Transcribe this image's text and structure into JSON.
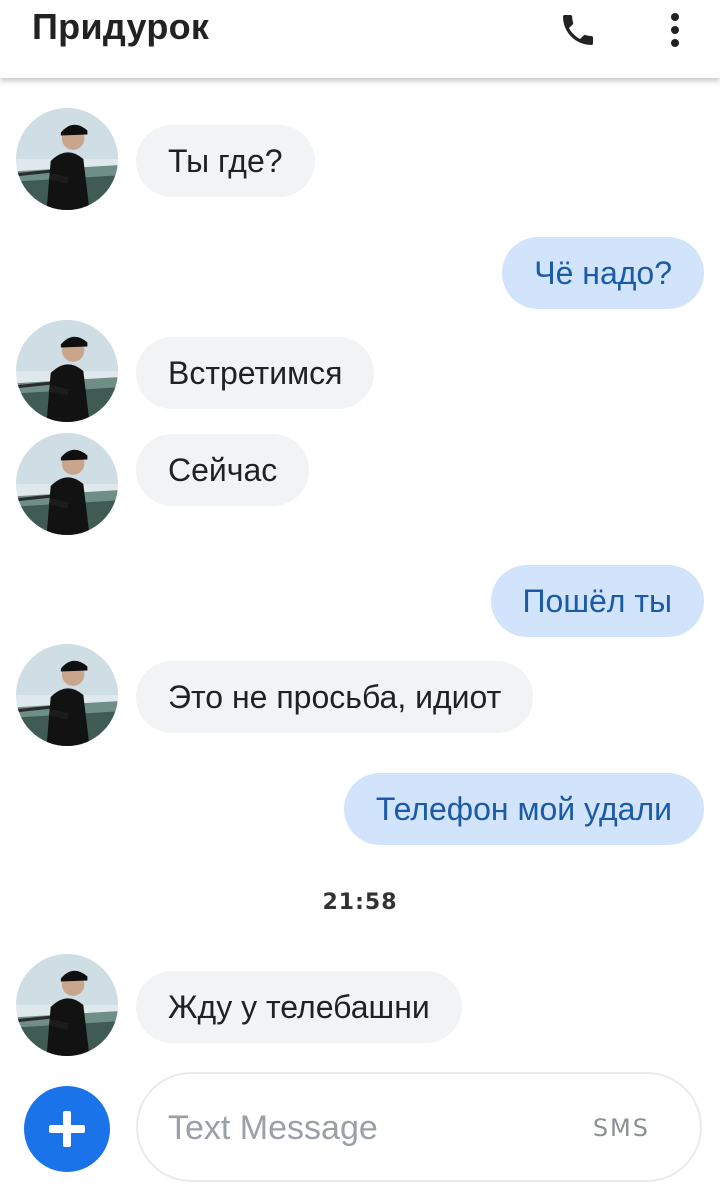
{
  "header": {
    "contact_name": "Придурок",
    "call_icon": "phone-icon",
    "more_icon": "more-vert-icon"
  },
  "messages": [
    {
      "direction": "incoming",
      "text": "Ты где?"
    },
    {
      "direction": "outgoing",
      "text": "Чё надо?"
    },
    {
      "direction": "incoming",
      "text": "Встретимся"
    },
    {
      "direction": "incoming",
      "text": "Сейчас"
    },
    {
      "direction": "outgoing",
      "text": "Пошёл ты"
    },
    {
      "direction": "incoming",
      "text": "Это не просьба, идиот"
    },
    {
      "direction": "outgoing",
      "text": "Телефон мой удали"
    },
    {
      "direction": "incoming",
      "text": "Жду у телебашни"
    }
  ],
  "timestamp": "21:58",
  "composer": {
    "placeholder": "Text Message",
    "mode_label": "SMS",
    "add_icon": "plus-icon"
  },
  "colors": {
    "incoming_bubble": "#f1f3f4",
    "outgoing_bubble": "#d2e3fc",
    "outgoing_text": "#1a5aa6",
    "accent": "#1a73e8"
  }
}
